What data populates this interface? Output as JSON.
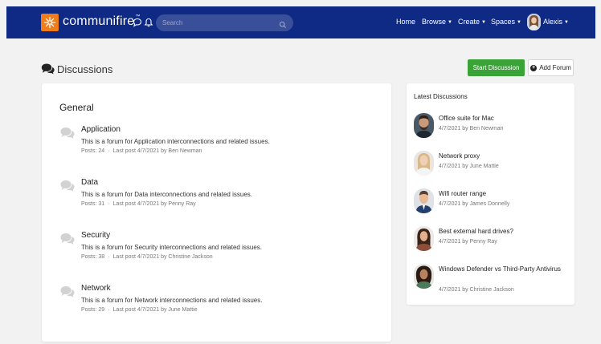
{
  "nav": {
    "brand": "communifire",
    "brand_tm": "™",
    "search_placeholder": "Search",
    "menu": [
      {
        "label": "Home",
        "has_caret": false
      },
      {
        "label": "Browse",
        "has_caret": true
      },
      {
        "label": "Create",
        "has_caret": true
      },
      {
        "label": "Spaces",
        "has_caret": true
      }
    ],
    "user_name": "Alexis",
    "colors": {
      "bar": "#0f2a85",
      "logo": "#f07d1a"
    }
  },
  "page": {
    "title": "Discussions",
    "start_button": "Start Discussion",
    "add_button": "Add Forum"
  },
  "forums": {
    "section_title": "General",
    "items": [
      {
        "name": "Application",
        "description": "This is a forum for Application interconnections and related issues.",
        "posts": "Posts: 24",
        "last_post": "Last post 4/7/2021 by Ben Newman"
      },
      {
        "name": "Data",
        "description": "This is a forum for Data interconnections and related issues.",
        "posts": "Posts: 31",
        "last_post": "Last post 4/7/2021 by Penny Ray"
      },
      {
        "name": "Security",
        "description": "This is a forum for Security interconnections and related issues.",
        "posts": "Posts: 38",
        "last_post": "Last post 4/7/2021 by Christine Jackson"
      },
      {
        "name": "Network",
        "description": "This is a forum for Network interconnections and related issues.",
        "posts": "Posts: 29",
        "last_post": "Last post 4/7/2021 by June Mattie"
      }
    ]
  },
  "latest": {
    "title": "Latest Discussions",
    "items": [
      {
        "title": "Office suite for Mac",
        "meta": "4/7/2021  by  Ben Newman",
        "avatar": "man-beard"
      },
      {
        "title": "Network proxy",
        "meta": "4/7/2021  by  June Mattie",
        "avatar": "woman-blonde"
      },
      {
        "title": "Wifi router range",
        "meta": "4/7/2021  by  James Donnelly",
        "avatar": "man-suit"
      },
      {
        "title": "Best external hard drives?",
        "meta": "4/7/2021  by  Penny Ray",
        "avatar": "woman-dark-hair"
      },
      {
        "title": "Windows Defender vs Third-Party Antivirus",
        "meta": "4/7/2021  by  Christine Jackson",
        "avatar": "woman-curly-hair"
      }
    ]
  }
}
